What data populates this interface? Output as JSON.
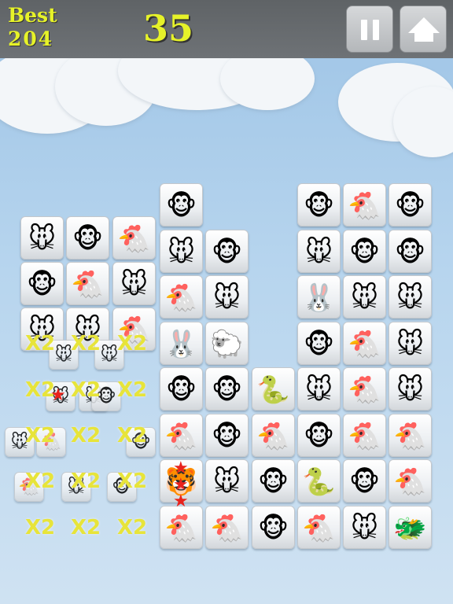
{
  "header": {
    "best_label": "Best",
    "best_value": "204",
    "score": "35",
    "pause_icon": "pause-icon",
    "up_icon": "up-arrow-icon"
  },
  "colors": {
    "score_text": "#e6f229",
    "multiplier_text": "#e7e43a",
    "topbar": "#64686b",
    "sky": "#b7d5ee"
  },
  "tiles": [
    {
      "kind": "monkey",
      "glyph": "🐵"
    },
    {
      "kind": "monkey",
      "glyph": "🐵"
    },
    {
      "kind": "rooster",
      "glyph": "🐔"
    },
    {
      "kind": "monkey",
      "glyph": "🐵"
    },
    {
      "kind": "mouse",
      "glyph": "🐭"
    },
    {
      "kind": "monkey",
      "glyph": "🐵"
    },
    {
      "kind": "rooster",
      "glyph": "🐔"
    },
    {
      "kind": "mouse",
      "glyph": "🐭"
    },
    {
      "kind": "monkey",
      "glyph": "🐵"
    },
    {
      "kind": "mouse",
      "glyph": "🐭"
    },
    {
      "kind": "monkey",
      "glyph": "🐵"
    },
    {
      "kind": "monkey",
      "glyph": "🐵"
    },
    {
      "kind": "monkey",
      "glyph": "🐵"
    },
    {
      "kind": "rooster",
      "glyph": "🐔"
    },
    {
      "kind": "mouse",
      "glyph": "🐭"
    },
    {
      "kind": "rooster",
      "glyph": "🐔"
    },
    {
      "kind": "mouse",
      "glyph": "🐭"
    },
    {
      "kind": "rabbit",
      "glyph": "🐰"
    },
    {
      "kind": "mouse",
      "glyph": "🐭"
    },
    {
      "kind": "mouse",
      "glyph": "🐭"
    },
    {
      "kind": "mouse",
      "glyph": "🐭"
    },
    {
      "kind": "mouse",
      "glyph": "🐭"
    },
    {
      "kind": "rooster",
      "glyph": "🐔"
    },
    {
      "kind": "rabbit",
      "glyph": "🐰"
    },
    {
      "kind": "sheep",
      "glyph": "🐑"
    },
    {
      "kind": "monkey",
      "glyph": "🐵"
    },
    {
      "kind": "rooster",
      "glyph": "🐔"
    },
    {
      "kind": "mouse",
      "glyph": "🐭"
    },
    {
      "kind": "monkey",
      "glyph": "🐵"
    },
    {
      "kind": "monkey",
      "glyph": "🐵"
    },
    {
      "kind": "snake",
      "glyph": "🐍"
    },
    {
      "kind": "mouse",
      "glyph": "🐭"
    },
    {
      "kind": "rooster",
      "glyph": "🐔"
    },
    {
      "kind": "mouse",
      "glyph": "🐭"
    },
    {
      "kind": "rooster",
      "glyph": "🐔"
    },
    {
      "kind": "monkey",
      "glyph": "🐵"
    },
    {
      "kind": "rooster",
      "glyph": "🐔"
    },
    {
      "kind": "monkey",
      "glyph": "🐵"
    },
    {
      "kind": "rooster",
      "glyph": "🐔"
    },
    {
      "kind": "rooster",
      "glyph": "🐔"
    },
    {
      "kind": "tiger",
      "glyph": "🐯"
    },
    {
      "kind": "mouse",
      "glyph": "🐭"
    },
    {
      "kind": "monkey",
      "glyph": "🐵"
    },
    {
      "kind": "snake",
      "glyph": "🐍"
    },
    {
      "kind": "monkey",
      "glyph": "🐵"
    },
    {
      "kind": "rooster",
      "glyph": "🐔"
    },
    {
      "kind": "rooster",
      "glyph": "🐔"
    },
    {
      "kind": "rooster",
      "glyph": "🐔"
    },
    {
      "kind": "monkey",
      "glyph": "🐵"
    },
    {
      "kind": "rooster",
      "glyph": "🐔"
    },
    {
      "kind": "mouse",
      "glyph": "🐭"
    },
    {
      "kind": "dragon",
      "glyph": "🐲"
    }
  ],
  "small_tiles": [
    {
      "kind": "mouse",
      "glyph": "🐭"
    },
    {
      "kind": "mouse",
      "glyph": "🐭"
    },
    {
      "kind": "mouse",
      "glyph": "🐭"
    },
    {
      "kind": "mouse",
      "glyph": "🐭"
    },
    {
      "kind": "monkey",
      "glyph": "🐵"
    },
    {
      "kind": "mouse",
      "glyph": "🐭"
    },
    {
      "kind": "rooster",
      "glyph": "🐔"
    },
    {
      "kind": "monkey",
      "glyph": "🐵"
    },
    {
      "kind": "rooster",
      "glyph": "🐔"
    },
    {
      "kind": "mouse",
      "glyph": "🐭"
    },
    {
      "kind": "monkey",
      "glyph": "🐵"
    }
  ],
  "multipliers": [
    "X2",
    "X2",
    "X2",
    "X2",
    "X2",
    "X2",
    "X2",
    "X2",
    "X2",
    "X2",
    "X2",
    "X2",
    "X2",
    "X2",
    "X2"
  ]
}
